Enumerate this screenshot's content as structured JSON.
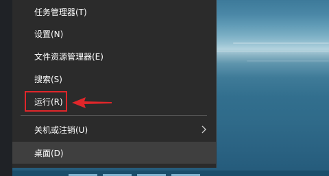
{
  "context_menu": {
    "items": [
      {
        "label": "任务管理器(T)"
      },
      {
        "label": "设置(N)"
      },
      {
        "label": "文件资源管理器(E)"
      },
      {
        "label": "搜索(S)"
      },
      {
        "label": "运行(R)"
      },
      {
        "label": "关机或注销(U)",
        "has_submenu": true
      },
      {
        "label": "桌面(D)",
        "hovered": true
      }
    ]
  },
  "annotation": {
    "highlight_color": "#e0262a",
    "arrow_icon": "red-arrow-left"
  },
  "colors": {
    "menu_bg": "#2b2b2b",
    "menu_hover": "#3f3f3f",
    "menu_text": "#ffffff"
  }
}
